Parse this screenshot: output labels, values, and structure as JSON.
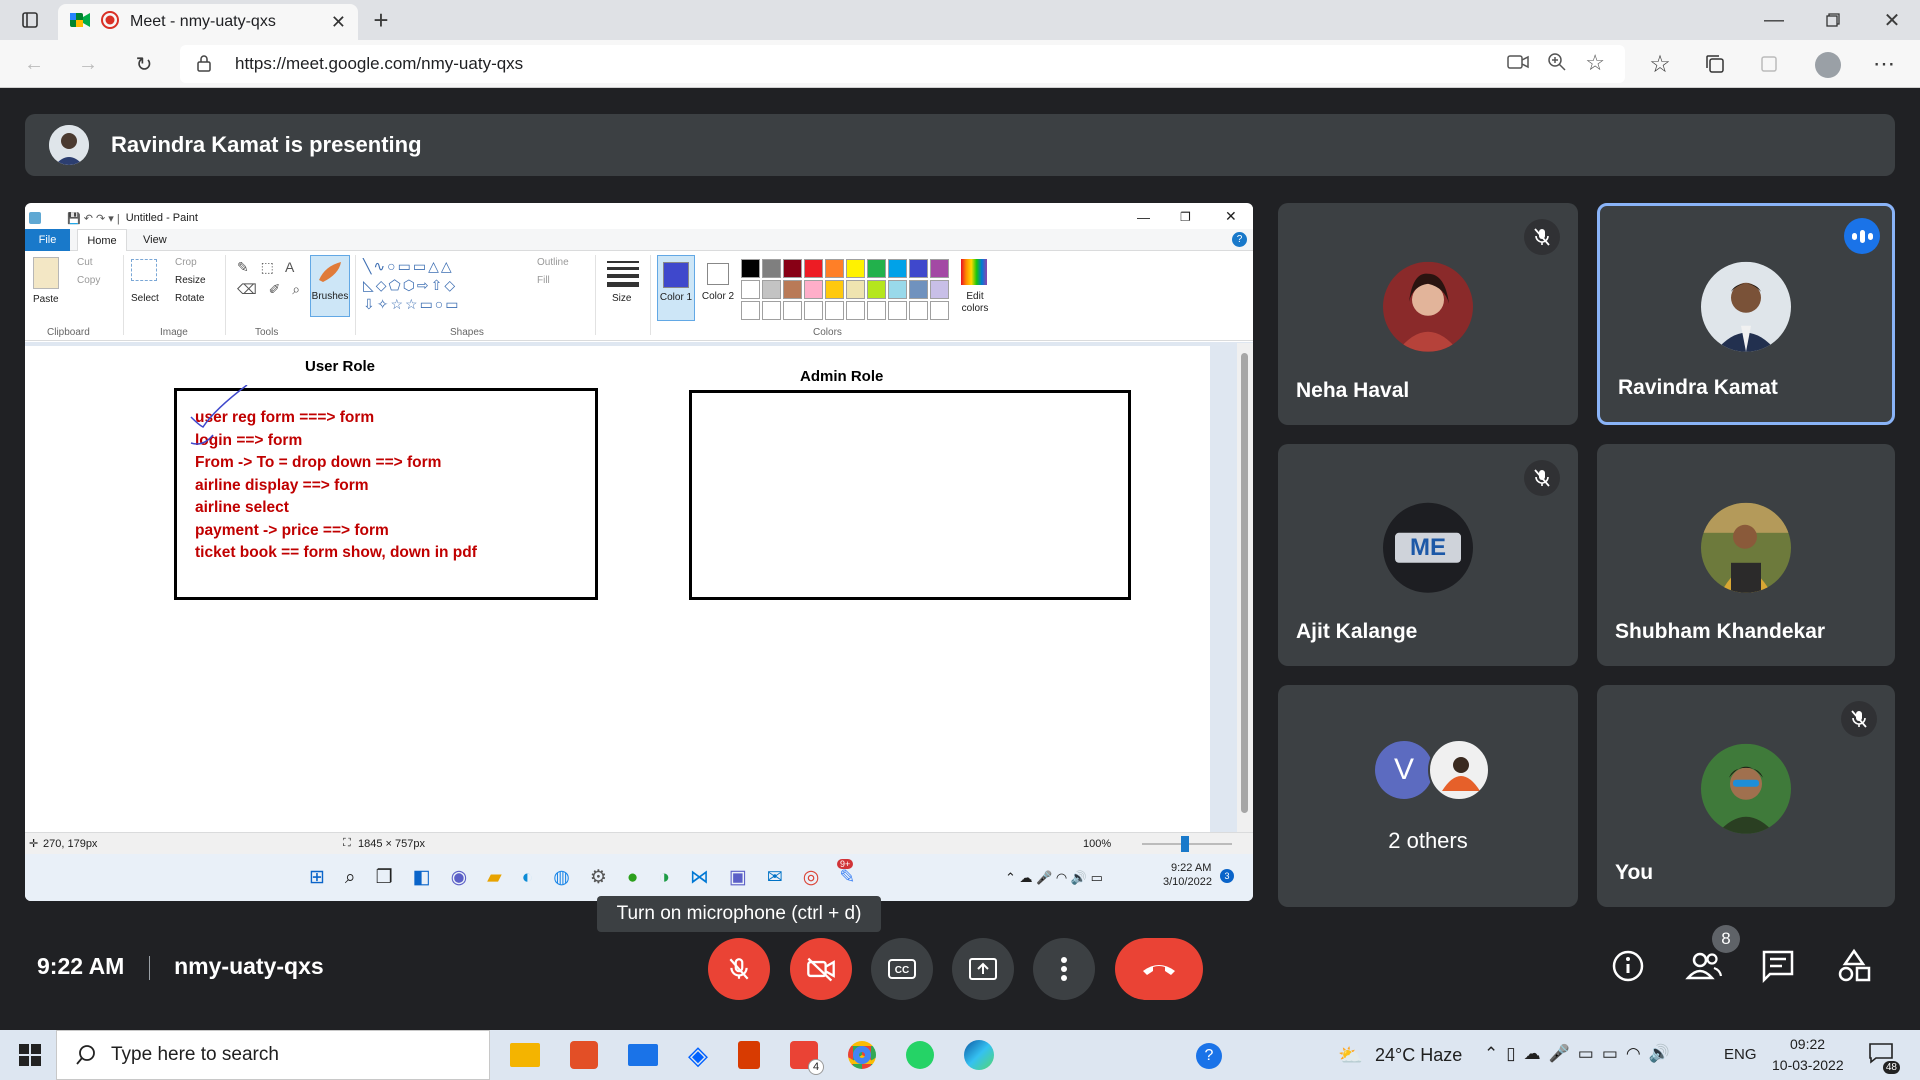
{
  "browser": {
    "tab_title": "Meet - nmy-uaty-qxs",
    "url": "https://meet.google.com/nmy-uaty-qxs"
  },
  "meet": {
    "presenting_text": "Ravindra Kamat is presenting",
    "time": "9:22 AM",
    "meeting_code": "nmy-uaty-qxs",
    "tooltip": "Turn on microphone (ctrl + d)",
    "people_count": "8",
    "participants": [
      {
        "name": "Neha Haval",
        "muted": true
      },
      {
        "name": "Ravindra Kamat",
        "muted": false,
        "speaking": true
      },
      {
        "name": "Ajit Kalange",
        "muted": true
      },
      {
        "name": "Shubham Khandekar",
        "muted": false
      },
      {
        "name": "2 others",
        "avatar_letter": "V"
      },
      {
        "name": "You",
        "muted": true
      }
    ],
    "me_logo_text": "ME"
  },
  "paint": {
    "title": "Untitled - Paint",
    "menu": [
      "File",
      "Home",
      "View"
    ],
    "clipboard": {
      "paste": "Paste",
      "cut": "Cut",
      "copy": "Copy",
      "group": "Clipboard"
    },
    "image": {
      "select": "Select",
      "crop": "Crop",
      "resize": "Resize",
      "rotate": "Rotate",
      "group": "Image"
    },
    "tools_group": "Tools",
    "brushes": "Brushes",
    "shapes_group": "Shapes",
    "outline": "Outline",
    "fill": "Fill",
    "size": "Size",
    "color1": "Color 1",
    "color2": "Color 2",
    "colors_group": "Colors",
    "edit_colors": "Edit colors",
    "palette_row1": [
      "#000000",
      "#7f7f7f",
      "#880015",
      "#ed1c24",
      "#ff7f27",
      "#fff200",
      "#22b14c",
      "#00a2e8",
      "#3f48cc",
      "#a349a4"
    ],
    "palette_row2": [
      "#ffffff",
      "#c3c3c3",
      "#b97a57",
      "#ffaec9",
      "#ffc90e",
      "#efe4b0",
      "#b5e61d",
      "#99d9ea",
      "#7092be",
      "#c8bfe7"
    ],
    "canvas": {
      "user_role_title": "User Role",
      "admin_role_title": "Admin Role",
      "user_role_lines": [
        "user reg form  ===>   form",
        "login  ==>    form",
        "From -> To  = drop down    ==> form",
        "airline display  ==> form",
        "airline select",
        "payment -> price   ==> form",
        "ticket book == form show, down in pdf"
      ]
    },
    "status": {
      "cursor": "270, 179px",
      "size": "1845 × 757px",
      "zoom": "100%"
    },
    "inner_taskbar": {
      "time": "9:22 AM",
      "date": "3/10/2022",
      "badge": "3",
      "teams_badge": "9+"
    }
  },
  "taskbar": {
    "search_placeholder": "Type here to search",
    "weather": "24°C  Haze",
    "lang": "ENG",
    "time": "09:22",
    "date": "10-03-2022",
    "notifications": "48",
    "gmail_badge": "4"
  }
}
